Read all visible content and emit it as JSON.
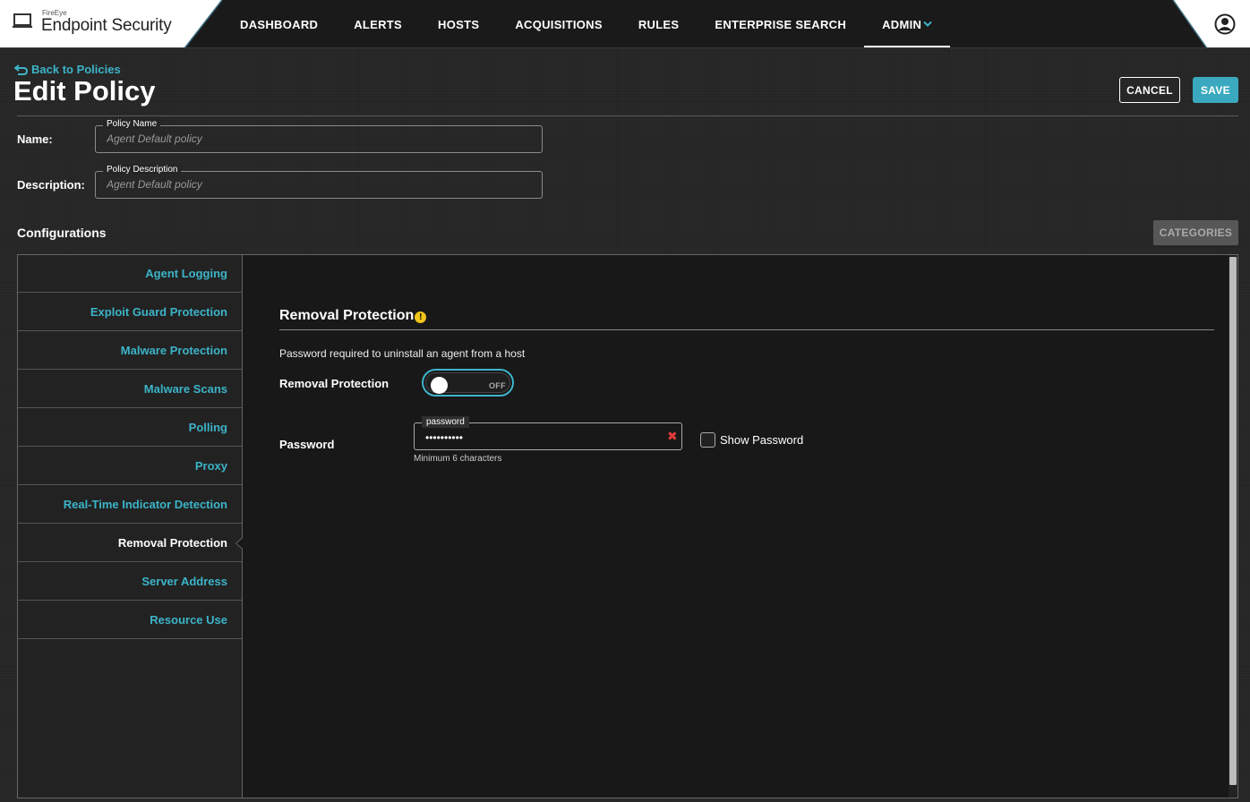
{
  "app": {
    "vendor": "FireEye",
    "product": "Endpoint Security"
  },
  "nav": {
    "items": [
      {
        "label": "DASHBOARD"
      },
      {
        "label": "ALERTS"
      },
      {
        "label": "HOSTS"
      },
      {
        "label": "ACQUISITIONS"
      },
      {
        "label": "RULES"
      },
      {
        "label": "ENTERPRISE SEARCH"
      },
      {
        "label": "ADMIN"
      }
    ],
    "active": "ADMIN"
  },
  "header": {
    "back_label": "Back to Policies",
    "title": "Edit Policy",
    "cancel_label": "CANCEL",
    "save_label": "SAVE"
  },
  "form": {
    "name_label": "Name:",
    "name_legend": "Policy Name",
    "name_placeholder": "Agent Default policy",
    "desc_label": "Description:",
    "desc_legend": "Policy Description",
    "desc_placeholder": "Agent Default policy"
  },
  "configurations": {
    "title": "Configurations",
    "categories_label": "CATEGORIES",
    "sidebar": [
      {
        "label": "Agent Logging"
      },
      {
        "label": "Exploit Guard Protection"
      },
      {
        "label": "Malware Protection"
      },
      {
        "label": "Malware Scans"
      },
      {
        "label": "Polling"
      },
      {
        "label": "Proxy"
      },
      {
        "label": "Real-Time Indicator Detection"
      },
      {
        "label": "Removal Protection"
      },
      {
        "label": "Server Address"
      },
      {
        "label": "Resource Use"
      }
    ],
    "active_item": "Removal Protection"
  },
  "section": {
    "title": "Removal Protection",
    "warning_glyph": "!",
    "description": "Password required to uninstall an agent from a host",
    "toggle_label": "Removal Protection",
    "toggle_state": "OFF",
    "password_label": "Password",
    "password_legend": "password",
    "password_value": "••••••••••",
    "password_hint": "Minimum 6 characters",
    "show_password_label": "Show Password",
    "clear_glyph": "✖"
  },
  "colors": {
    "accent": "#3cb4c8",
    "background": "#252525",
    "warning": "#f0c419",
    "error": "#e23b3b"
  },
  "icons": [
    "monitor-icon",
    "back-arrow-icon",
    "chevron-down-icon",
    "user-circle-icon",
    "warning-icon",
    "clear-icon"
  ]
}
